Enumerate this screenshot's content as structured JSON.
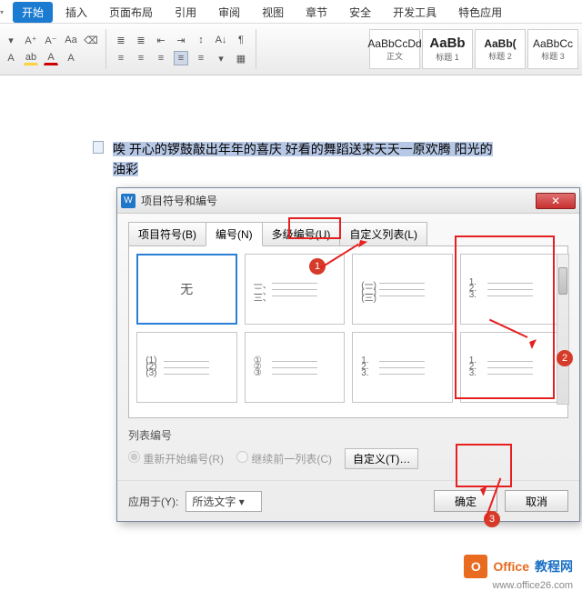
{
  "ribbon": {
    "tabs": [
      "开始",
      "插入",
      "页面布局",
      "引用",
      "审阅",
      "视图",
      "章节",
      "安全",
      "开发工具",
      "特色应用"
    ],
    "active_tab": "开始",
    "font_group": {
      "grow": "A⁺",
      "shrink": "A⁻",
      "clear": "⌫",
      "case": "Aa"
    },
    "styles": [
      {
        "preview": "AaBbCcDd",
        "name": "正文"
      },
      {
        "preview": "AaBb",
        "name": "标题 1"
      },
      {
        "preview": "AaBb(",
        "name": "标题 2"
      },
      {
        "preview": "AaBbCc",
        "name": "标题 3"
      }
    ]
  },
  "document": {
    "line1": "唉  开心的锣鼓敲出年年的喜庆  好看的舞蹈送来天天一原欢腾  阳光的",
    "line2_prefix": "油彩"
  },
  "dialog": {
    "title": "项目符号和编号",
    "tabs": [
      "项目符号(B)",
      "编号(N)",
      "多级编号(U)",
      "自定义列表(L)"
    ],
    "active_tab": "编号(N)",
    "options": {
      "none": "无",
      "o1": [
        "一、",
        "二、",
        "三、"
      ],
      "o2": [
        "(一)",
        "(二)",
        "(三)"
      ],
      "o3": [
        "1.",
        "2.",
        "3."
      ],
      "o4": [
        "(1)",
        "(2)",
        "(3)"
      ],
      "o5": [
        "①",
        "②",
        "③"
      ],
      "o6": [
        "1.",
        "2.",
        "3."
      ],
      "o7": [
        "1.",
        "2.",
        "3."
      ]
    },
    "list_numbering_label": "列表编号",
    "radio_restart": "重新开始编号(R)",
    "radio_continue": "继续前一列表(C)",
    "custom_btn": "自定义(T)…",
    "apply_label": "应用于(Y):",
    "apply_value": "所选文字",
    "ok": "确定",
    "cancel": "取消"
  },
  "annotations": {
    "badge1": "1",
    "badge2": "2",
    "badge3": "3"
  },
  "watermark": {
    "brand1": "Office",
    "brand2": "教程网",
    "url": "www.office26.com"
  }
}
